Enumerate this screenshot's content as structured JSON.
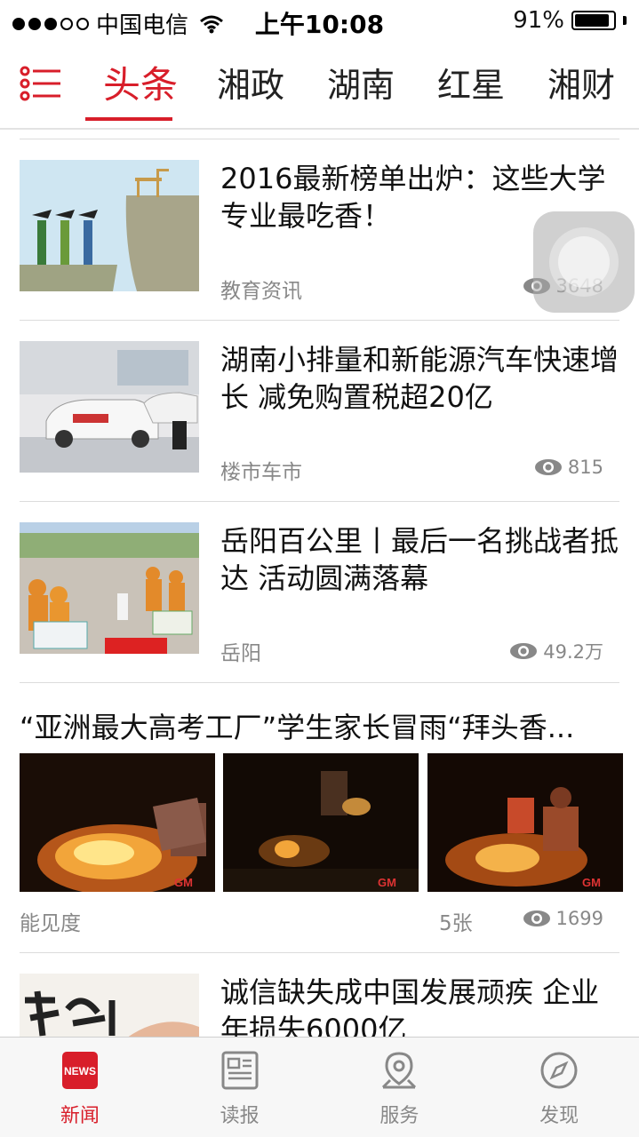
{
  "status_bar": {
    "carrier": "中国电信",
    "time": "上午10:08",
    "battery": "91%",
    "battery_level": 0.91
  },
  "nav": {
    "tabs": [
      {
        "label": "头条",
        "active": true
      },
      {
        "label": "湘政"
      },
      {
        "label": "湖南"
      },
      {
        "label": "红星"
      },
      {
        "label": "湘财"
      }
    ]
  },
  "feed": [
    {
      "title": "2016最新榜单出炉：这些大学专业最吃香！",
      "category": "教育资讯",
      "views": "3648"
    },
    {
      "title": "湖南小排量和新能源汽车快速增长 减免购置税超20亿",
      "category": "楼市车市",
      "views": "815"
    },
    {
      "title": "岳阳百公里丨最后一名挑战者抵达 活动圆满落幕",
      "category": "岳阳",
      "views": "49.2万"
    },
    {
      "title": "“亚洲最大高考工厂”学生家长冒雨“拜头香...",
      "category": "能见度",
      "count": "5张",
      "views": "1699"
    },
    {
      "title": "诚信缺失成中国发展顽疾 企业年损失6000亿"
    }
  ],
  "tabbar": {
    "items": [
      {
        "label": "新闻",
        "active": true,
        "icon": "news-icon",
        "badge": "NEWS"
      },
      {
        "label": "读报",
        "icon": "newspaper-icon"
      },
      {
        "label": "服务",
        "icon": "location-pin-icon"
      },
      {
        "label": "发现",
        "icon": "compass-icon"
      }
    ]
  },
  "colors": {
    "accent": "#d81e2a",
    "meta": "#888888"
  }
}
